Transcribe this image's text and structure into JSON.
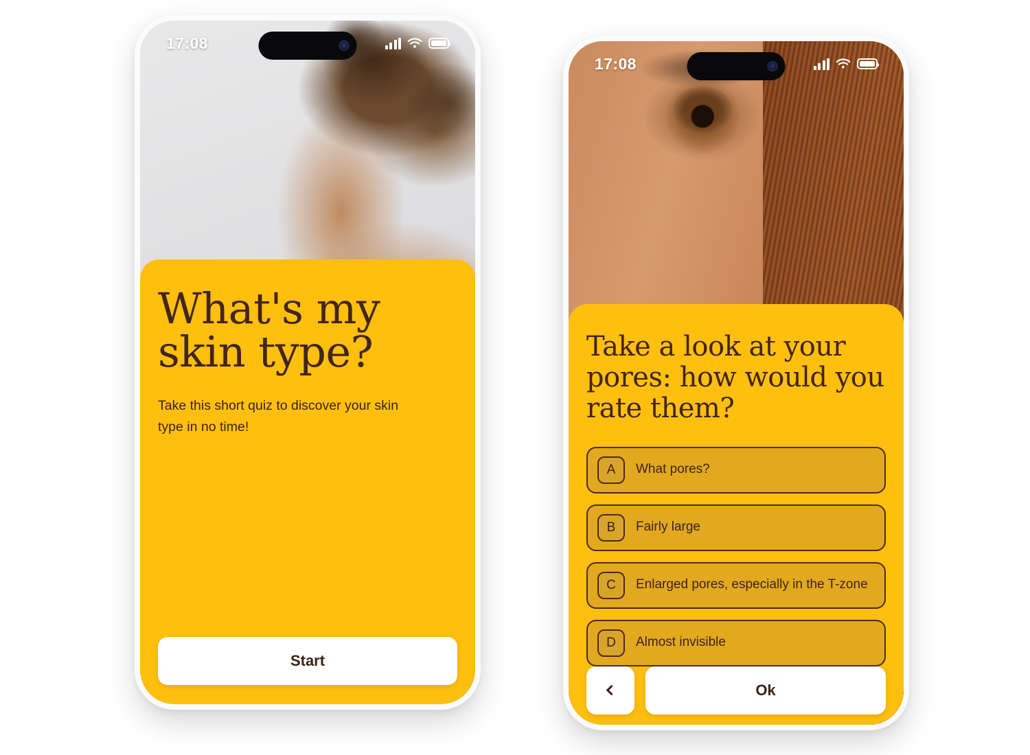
{
  "app": {
    "accent_yellow": "#FEBF0F",
    "option_fill": "#E2A91F",
    "badge_fill": "#D9A42A",
    "text_dark": "#3C2218",
    "button_white": "#FFFFFF"
  },
  "screens": [
    {
      "id": "intro",
      "status_bar": {
        "time": "17:08",
        "signal_icon": "cellular-signal-icon",
        "wifi_icon": "wifi-icon",
        "battery_icon": "battery-full-icon"
      },
      "hero_photo_alt": "woman-shoulder-and-neck-photo",
      "title": "What's my skin type?",
      "subtitle": "Take this short quiz to discover your skin type in no time!",
      "primary_button": "Start"
    },
    {
      "id": "question-pores",
      "status_bar": {
        "time": "17:08",
        "signal_icon": "cellular-signal-icon",
        "wifi_icon": "wifi-icon",
        "battery_icon": "battery-full-icon"
      },
      "hero_photo_alt": "close-up-eye-and-skin-pores-photo",
      "title": "Take a look at your pores: how would you rate them?",
      "options": [
        {
          "key": "A",
          "label": "What pores?"
        },
        {
          "key": "B",
          "label": "Fairly large"
        },
        {
          "key": "C",
          "label": "Enlarged pores, especially in the T-zone"
        },
        {
          "key": "D",
          "label": "Almost invisible"
        }
      ],
      "back_button": "‹",
      "primary_button": "Ok"
    }
  ]
}
